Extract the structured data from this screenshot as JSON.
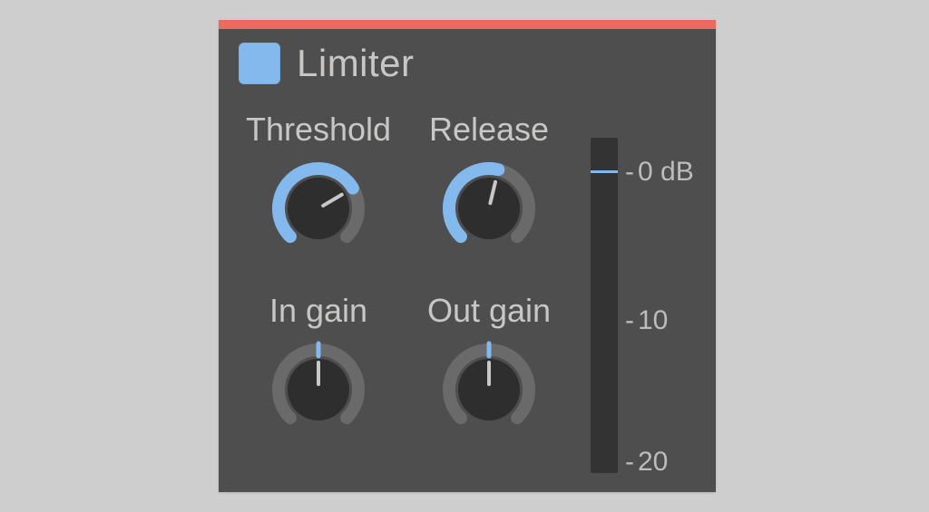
{
  "colors": {
    "accent": "#83b9ed",
    "topbar": "#ed6a5e",
    "panel_bg": "#4e4e4e",
    "page_bg": "#cfcecf",
    "text": "#c8c7c6",
    "knob_body": "#2e2e2e",
    "ring_bg": "#6a6a6a",
    "meter_bg": "#333333"
  },
  "header": {
    "title": "Limiter",
    "enabled": true
  },
  "knobs": {
    "threshold": {
      "label": "Threshold",
      "value": 0.72,
      "arc": "full"
    },
    "release": {
      "label": "Release",
      "value": 0.55,
      "arc": "full"
    },
    "in_gain": {
      "label": "In gain",
      "value": 0.5,
      "arc": "center"
    },
    "out_gain": {
      "label": "Out gain",
      "value": 0.5,
      "arc": "center"
    }
  },
  "meter": {
    "scale_labels": [
      "0 dB",
      "10",
      "20"
    ],
    "marker_value": 0
  }
}
